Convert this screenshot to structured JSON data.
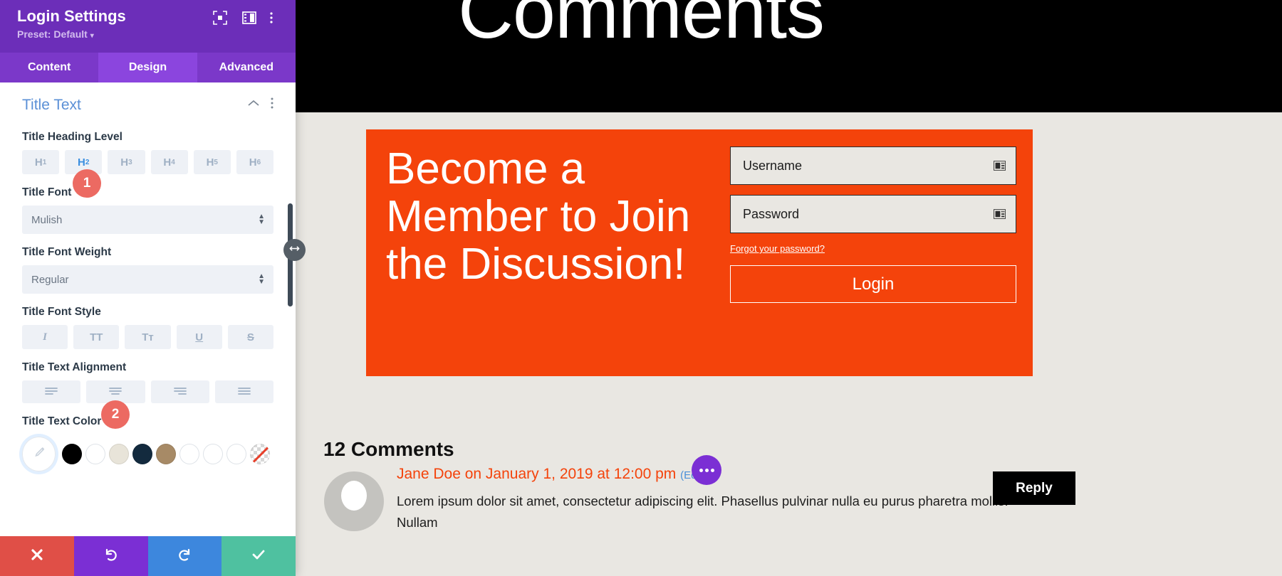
{
  "preview": {
    "header_title": "Comments",
    "login_module": {
      "heading": "Become a Member to Join the Discussion!",
      "username_label": "Username",
      "password_label": "Password",
      "forgot_link": "Forgot your password?",
      "login_button": "Login",
      "background_color": "#f4430b"
    },
    "comments": {
      "count_label": "12 Comments",
      "meta": "Jane Doe on January 1, 2019 at 12:00 pm",
      "edit_label": "(Edit)",
      "body": "Lorem ipsum dolor sit amet, consectetur adipiscing elit. Phasellus pulvinar nulla eu purus pharetra mollis. Nullam",
      "reply_label": "Reply"
    }
  },
  "panel": {
    "title": "Login Settings",
    "preset": "Preset: Default",
    "preset_caret": "▾",
    "header_icons": [
      {
        "name": "focus-icon"
      },
      {
        "name": "layout-icon"
      },
      {
        "name": "kebab-menu-icon"
      }
    ],
    "tabs": [
      {
        "label": "Content",
        "active": false
      },
      {
        "label": "Design",
        "active": true
      },
      {
        "label": "Advanced",
        "active": false
      }
    ],
    "section": {
      "title": "Title Text",
      "collapse_icon": "chevron-up-icon",
      "options_icon": "kebab-menu-icon"
    },
    "fields": {
      "heading_level": {
        "label": "Title Heading Level",
        "options": [
          "H1",
          "H2",
          "H3",
          "H4",
          "H5",
          "H6"
        ],
        "selected": "H2"
      },
      "title_font": {
        "label": "Title Font",
        "value": "Mulish"
      },
      "title_font_weight": {
        "label": "Title Font Weight",
        "value": "Regular"
      },
      "font_style": {
        "label": "Title Font Style",
        "options": [
          "italic",
          "uppercase",
          "small-caps",
          "underline",
          "strikethrough"
        ],
        "glyphs": [
          "I",
          "TT",
          "Tᴛ",
          "U",
          "S"
        ],
        "selected": ""
      },
      "text_alignment": {
        "label": "Title Text Alignment",
        "options": [
          "left",
          "center",
          "right",
          "justify"
        ],
        "selected": ""
      },
      "text_color": {
        "label": "Title Text Color",
        "picker_icon": "eyedropper-icon",
        "swatches": [
          "#000000",
          "#ffffff",
          "#e8e4d9",
          "#132a3e",
          "#a78a66",
          "#ffffff",
          "#ffffff",
          "#ffffff"
        ],
        "none_swatch": "transparent"
      }
    },
    "footer": [
      {
        "name": "cancel-button",
        "icon": "close-icon",
        "color": "#e04f47"
      },
      {
        "name": "undo-button",
        "icon": "undo-icon",
        "color": "#7b2fd4"
      },
      {
        "name": "redo-button",
        "icon": "redo-icon",
        "color": "#3d87dd"
      },
      {
        "name": "save-button",
        "icon": "check-icon",
        "color": "#4fc1a0"
      }
    ],
    "callouts": [
      {
        "number": "1"
      },
      {
        "number": "2"
      }
    ]
  }
}
